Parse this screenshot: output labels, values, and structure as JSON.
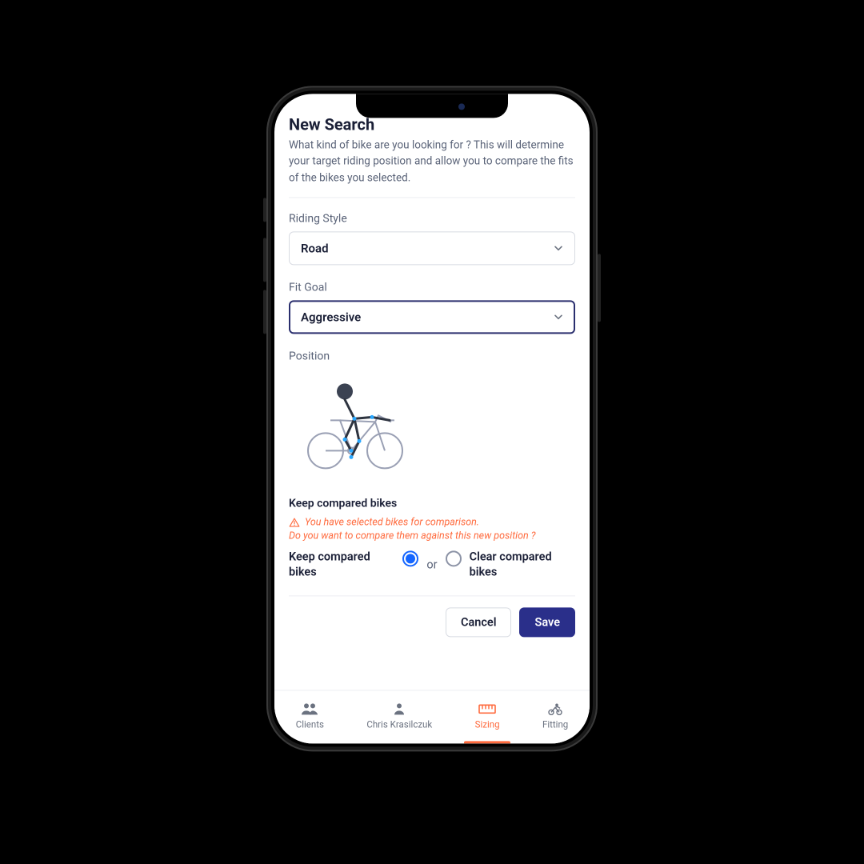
{
  "header": {
    "title": "New Search",
    "intro": "What kind of bike are you looking for ? This will determine your target riding position and allow you to compare the fits of the bikes you selected."
  },
  "form": {
    "riding_style_label": "Riding Style",
    "riding_style_value": "Road",
    "fit_goal_label": "Fit Goal",
    "fit_goal_value": "Aggressive",
    "position_label": "Position"
  },
  "compare": {
    "section_label": "Keep compared bikes",
    "warning1": "You have selected bikes for comparison.",
    "warning2": "Do you want to compare them against this new position ?",
    "option_keep": "Keep compared bikes",
    "or": "or",
    "option_clear": "Clear compared bikes",
    "selected": "keep"
  },
  "buttons": {
    "cancel": "Cancel",
    "save": "Save"
  },
  "nav": {
    "items": [
      {
        "label": "Clients"
      },
      {
        "label": "Chris Krasilczuk"
      },
      {
        "label": "Sizing"
      },
      {
        "label": "Fitting"
      }
    ],
    "active_index": 2
  }
}
